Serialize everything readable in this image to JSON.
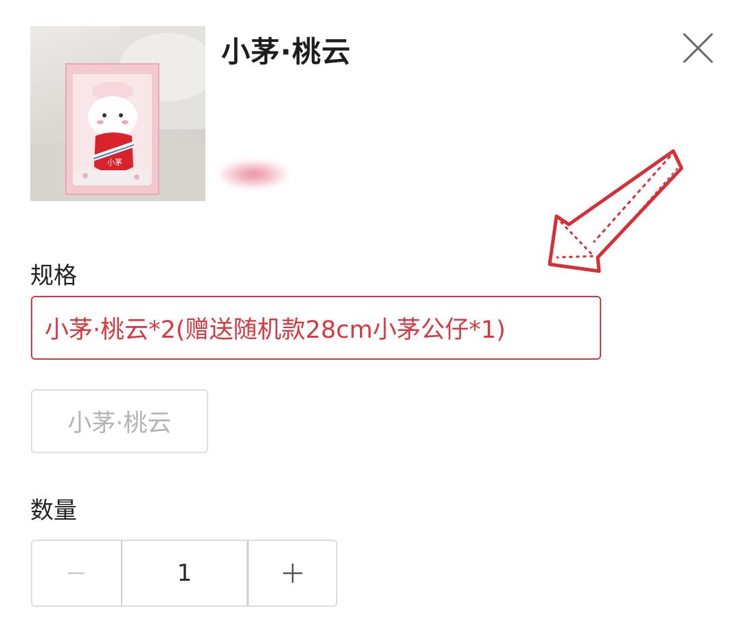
{
  "product": {
    "title": "小茅·桃云",
    "thumbnail_icon": "plush-gift-box-image",
    "package_text": "小茅"
  },
  "spec": {
    "label": "规格",
    "options": [
      {
        "label": "小茅·桃云*2(赠送随机款28cm小茅公仔*1)",
        "selected": true
      },
      {
        "label": "小茅·桃云",
        "selected": false
      }
    ]
  },
  "quantity": {
    "label": "数量",
    "value": "1",
    "minus_icon": "minus-icon",
    "plus_icon": "plus-icon"
  },
  "colors": {
    "accent": "#d8373f",
    "annotation_arrow": "#d62f36"
  }
}
